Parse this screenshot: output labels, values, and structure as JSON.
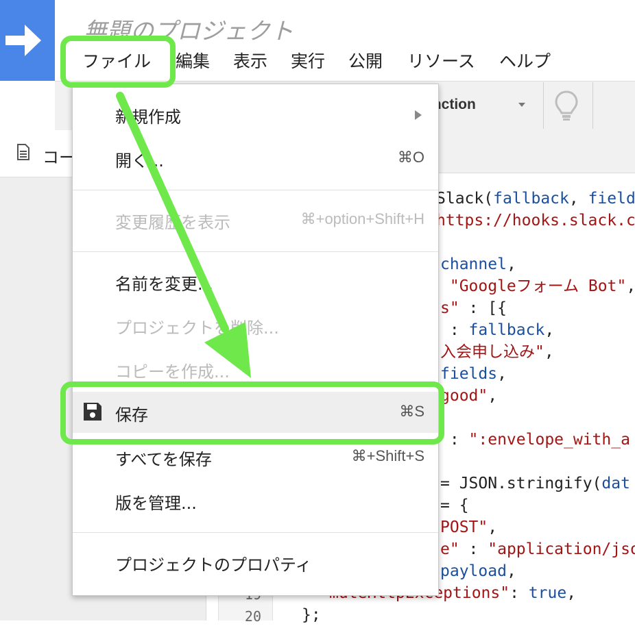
{
  "app": {
    "project_title": "無題のプロジェクト"
  },
  "menubar": {
    "items": [
      "ファイル",
      "編集",
      "表示",
      "実行",
      "公開",
      "リソース",
      "ヘルプ"
    ]
  },
  "toolbar": {
    "function_select": "unction",
    "icons": [
      "lightbulb-icon"
    ]
  },
  "sidebar": {
    "file_label": "コー"
  },
  "editor": {
    "gutter_numbers": [
      "19",
      "20"
    ],
    "lines": [
      [
        {
          "t": "Slack(",
          "c": "k"
        },
        {
          "t": "fallback",
          "c": "b"
        },
        {
          "t": ", ",
          "c": "k"
        },
        {
          "t": "field",
          "c": "b"
        }
      ],
      [
        {
          "t": "https://hooks.slack.c",
          "c": "r"
        }
      ],
      [
        {
          "t": "",
          "c": "k"
        }
      ],
      [
        {
          "t": "channel",
          "c": "b"
        },
        {
          "t": ",",
          "c": "k"
        }
      ],
      [
        {
          "t": " \"Googleフォーム Bot\"",
          "c": "r"
        },
        {
          "t": ",",
          "c": "k"
        }
      ],
      [
        {
          "t": "s\"",
          "c": "r"
        },
        {
          "t": " : [{",
          "c": "k"
        }
      ],
      [
        {
          "t": " : ",
          "c": "k"
        },
        {
          "t": "fallback",
          "c": "b"
        },
        {
          "t": ",",
          "c": "k"
        }
      ],
      [
        {
          "t": "入会申し込み\"",
          "c": "r"
        },
        {
          "t": ",",
          "c": "k"
        }
      ],
      [
        {
          "t": "fields",
          "c": "b"
        },
        {
          "t": ",",
          "c": "k"
        }
      ],
      [
        {
          "t": "good\"",
          "c": "r"
        },
        {
          "t": ",",
          "c": "k"
        }
      ],
      [
        {
          "t": "",
          "c": "k"
        }
      ],
      [
        {
          "t": " : ",
          "c": "k"
        },
        {
          "t": "\":envelope_with_a",
          "c": "r"
        }
      ],
      [
        {
          "t": "",
          "c": "k"
        }
      ],
      [
        {
          "t": "= JSON.stringify(",
          "c": "k"
        },
        {
          "t": "dat",
          "c": "b"
        }
      ],
      [
        {
          "t": "= {",
          "c": "k"
        }
      ],
      [
        {
          "t": "POST\"",
          "c": "r"
        },
        {
          "t": ",",
          "c": "k"
        }
      ],
      [
        {
          "t": "e\"",
          "c": "r"
        },
        {
          "t": " : ",
          "c": "k"
        },
        {
          "t": "\"application/jso",
          "c": "r"
        }
      ],
      [
        {
          "t": "payload",
          "c": "b"
        },
        {
          "t": ",",
          "c": "k"
        }
      ],
      [
        {
          "t": "muteHttpExceptions\"",
          "c": "r"
        },
        {
          "t": ": ",
          "c": "k"
        },
        {
          "t": "true",
          "c": "b"
        },
        {
          "t": ",",
          "c": "k"
        }
      ],
      [
        {
          "t": "};",
          "c": "k"
        }
      ]
    ]
  },
  "file_menu": {
    "new": {
      "label": "新規作成"
    },
    "open": {
      "label": "開く...",
      "shortcut": "⌘O"
    },
    "history": {
      "label": "変更履歴を表示",
      "shortcut": "⌘+option+Shift+H"
    },
    "rename": {
      "label": "名前を変更..."
    },
    "delete": {
      "label": "プロジェクトを削除..."
    },
    "copy": {
      "label": "コピーを作成..."
    },
    "save": {
      "label": "保存",
      "shortcut": "⌘S"
    },
    "save_all": {
      "label": "すべてを保存",
      "shortcut": "⌘+Shift+S"
    },
    "versions": {
      "label": "版を管理..."
    },
    "properties": {
      "label": "プロジェクトのプロパティ"
    }
  },
  "colors": {
    "highlight": "#6ee84a",
    "brand": "#4a86e8"
  }
}
